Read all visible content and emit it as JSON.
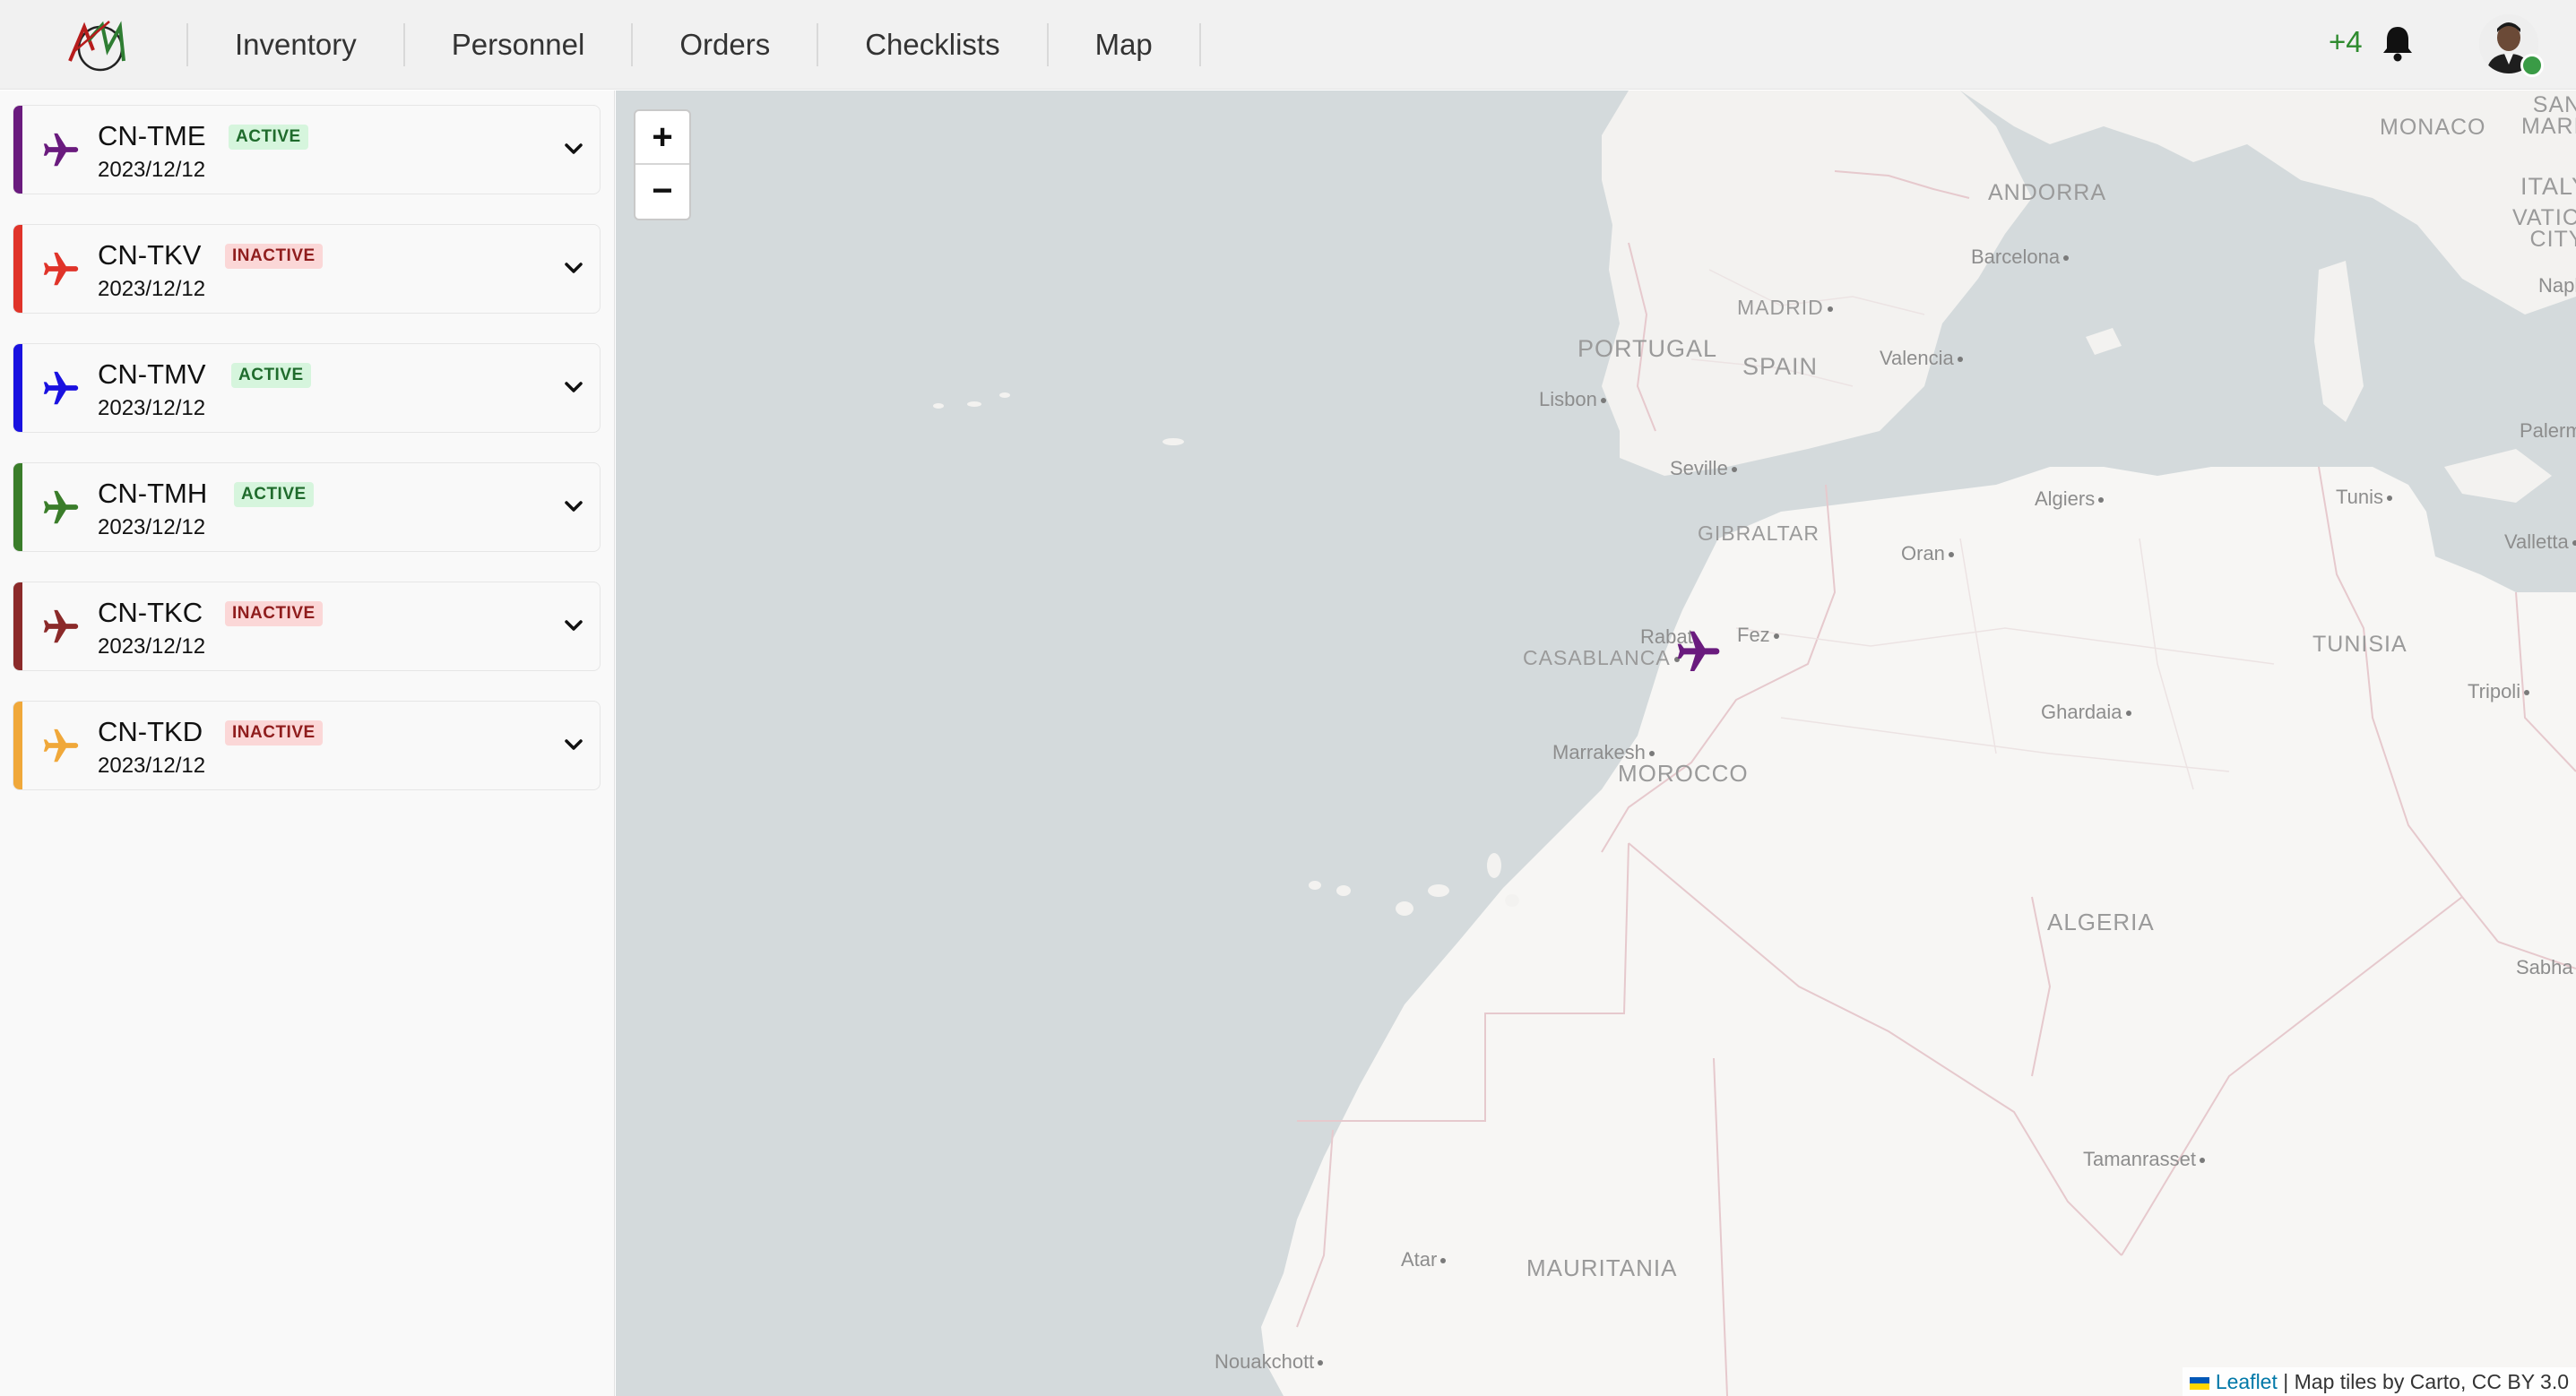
{
  "nav": {
    "items": [
      "Inventory",
      "Personnel",
      "Orders",
      "Checklists",
      "Map"
    ],
    "notification_count": "+4"
  },
  "aircraft": [
    {
      "reg": "CN-TME",
      "status": "ACTIVE",
      "date": "2023/12/12",
      "color": "#6a1b7e"
    },
    {
      "reg": "CN-TKV",
      "status": "INACTIVE",
      "date": "2023/12/12",
      "color": "#e0342a"
    },
    {
      "reg": "CN-TMV",
      "status": "ACTIVE",
      "date": "2023/12/12",
      "color": "#1a12e0"
    },
    {
      "reg": "CN-TMH",
      "status": "ACTIVE",
      "date": "2023/12/12",
      "color": "#3a7d2a"
    },
    {
      "reg": "CN-TKC",
      "status": "INACTIVE",
      "date": "2023/12/12",
      "color": "#8b2a2a"
    },
    {
      "reg": "CN-TKD",
      "status": "INACTIVE",
      "date": "2023/12/12",
      "color": "#f0a83a"
    }
  ],
  "map": {
    "zoom_in": "+",
    "zoom_out": "−",
    "labels": {
      "monaco": "MONACO",
      "san_marino": "SAN MARINO",
      "andorra": "ANDORRA",
      "italy": "ITALY",
      "vatican": "VATICAN CITY",
      "barcelona": "Barcelona",
      "madrid": "MADRID",
      "portugal": "PORTUGAL",
      "spain": "SPAIN",
      "valencia": "Valencia",
      "lisbon": "Lisbon",
      "naples": "Naples",
      "palermo": "Palermo",
      "seville": "Seville",
      "gibraltar": "GIBRALTAR",
      "algiers": "Algiers",
      "tunis": "Tunis",
      "valletta": "Valletta",
      "oran": "Oran",
      "rabat": "Rabat",
      "fez": "Fez",
      "casablanca": "CASABLANCA",
      "tunisia": "TUNISIA",
      "tripoli": "Tripoli",
      "ghardaia": "Ghardaia",
      "marrakesh": "Marrakesh",
      "morocco": "MOROCCO",
      "algeria": "ALGERIA",
      "sabha": "Sabha",
      "tamanrasset": "Tamanrasset",
      "atar": "Atar",
      "mauritania": "MAURITANIA",
      "nouakchott": "Nouakchott"
    },
    "attribution_link": "Leaflet",
    "attribution_text": "| Map tiles by Carto, CC BY 3.0"
  },
  "marker_color": "#6a1b7e"
}
